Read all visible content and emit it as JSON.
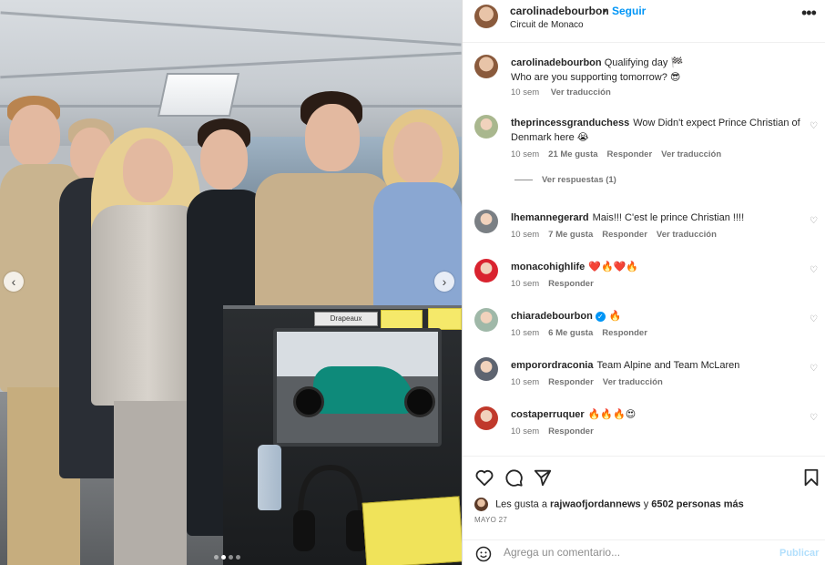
{
  "post": {
    "username": "carolinadebourbon",
    "separator": "•",
    "follow_label": "Seguir",
    "location": "Circuit de Monaco",
    "more_label": "•••",
    "caption_line1": "Qualifying day 🏁",
    "caption_line2": "Who are you supporting tomorrow? 😎",
    "caption_time": "10 sem",
    "caption_translate": "Ver traducción"
  },
  "photo": {
    "console_label": "Drapeaux",
    "prev_icon": "chevron-left-icon",
    "next_icon": "chevron-right-icon",
    "slides_total": 4,
    "active_slide": 2
  },
  "comments": [
    {
      "username": "theprincessgranduchess",
      "text": "Wow Didn't expect Prince Christian of Denmark here 😭",
      "time": "10 sem",
      "likes": "21 Me gusta",
      "reply": "Responder",
      "translate": "Ver traducción",
      "avatar_color": "#a9b78e",
      "view_replies": "Ver respuestas (1)"
    },
    {
      "username": "lhemannegerard",
      "text": "Mais!!! C'est le prince Christian !!!!",
      "time": "10 sem",
      "likes": "7 Me gusta",
      "reply": "Responder",
      "translate": "Ver traducción",
      "avatar_color": "#7a7f84"
    },
    {
      "username": "monacohighlife",
      "text": "❤️🔥❤️🔥",
      "time": "10 sem",
      "reply": "Responder",
      "avatar_color": "#d9232f"
    },
    {
      "username": "chiaradebourbon",
      "verified": "✓",
      "text": "🔥",
      "time": "10 sem",
      "likes": "6 Me gusta",
      "reply": "Responder",
      "avatar_color": "#9fb8a8"
    },
    {
      "username": "emporordraconia",
      "text": "Team Alpine and Team McLaren",
      "time": "10 sem",
      "reply": "Responder",
      "translate": "Ver traducción",
      "avatar_color": "#5e6470"
    },
    {
      "username": "costaperruquer",
      "text": "🔥🔥🔥😍",
      "time": "10 sem",
      "reply": "Responder",
      "avatar_color": "#c0392b"
    }
  ],
  "actions": {
    "like_icon": "heart-icon",
    "comment_icon": "comment-icon",
    "share_icon": "send-icon",
    "save_icon": "bookmark-icon"
  },
  "likes": {
    "prefix": "Les gusta a",
    "user": "rajwaofjordannews",
    "connector": "y",
    "others": "6502 personas más"
  },
  "date": "MAYO 27",
  "add_comment": {
    "placeholder": "Agrega un comentario...",
    "publish_label": "Publicar"
  }
}
